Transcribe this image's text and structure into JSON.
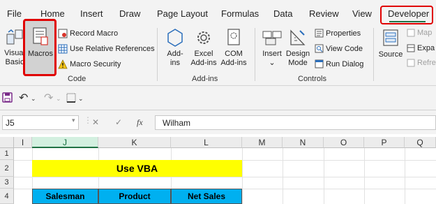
{
  "ribbon_tabs": [
    "File",
    "Home",
    "Insert",
    "Draw",
    "Page Layout",
    "Formulas",
    "Data",
    "Review",
    "View",
    "Developer"
  ],
  "active_tab": "Developer",
  "code_group": {
    "visual_basic_line1": "Visual",
    "visual_basic_line2": "Basic",
    "macros": "Macros",
    "record_macro": "Record Macro",
    "use_relative_references": "Use Relative References",
    "macro_security": "Macro Security",
    "group_label": "Code"
  },
  "addins_group": {
    "addins_line1": "Add-",
    "addins_line2": "ins",
    "excel_addins_line1": "Excel",
    "excel_addins_line2": "Add-ins",
    "com_addins_line1": "COM",
    "com_addins_line2": "Add-ins",
    "group_label": "Add-ins"
  },
  "controls_group": {
    "insert": "Insert",
    "insert_chevron": "⌄",
    "design_mode_line1": "Design",
    "design_mode_line2": "Mode",
    "properties": "Properties",
    "view_code": "View Code",
    "run_dialog": "Run Dialog",
    "group_label": "Controls"
  },
  "xml_group": {
    "source": "Source",
    "map_properties": "Map",
    "expansion_packs": "Expa",
    "refresh_data": "Refre"
  },
  "quick_access": {
    "save_icon": "save-icon",
    "undo_icon": "undo-icon",
    "redo_icon": "redo-icon",
    "borders_icon": "borders-icon",
    "more_chevron": "⌄"
  },
  "formula_bar": {
    "name_box": "J5",
    "fx": "fx",
    "cancel_glyph": "✕",
    "enter_glyph": "✓",
    "value": "Wilham"
  },
  "grid": {
    "columns": [
      "I",
      "J",
      "K",
      "L",
      "M",
      "N",
      "O",
      "P",
      "Q"
    ],
    "selected_column": "J",
    "rows": [
      "1",
      "2",
      "3",
      "4"
    ],
    "title_cell": "Use VBA",
    "headers": [
      "Salesman",
      "Product",
      "Net Sales"
    ]
  },
  "colors": {
    "excel_green": "#217346",
    "highlight_red": "#e00000",
    "title_fill": "#ffff00",
    "header_fill": "#00b0f0"
  }
}
